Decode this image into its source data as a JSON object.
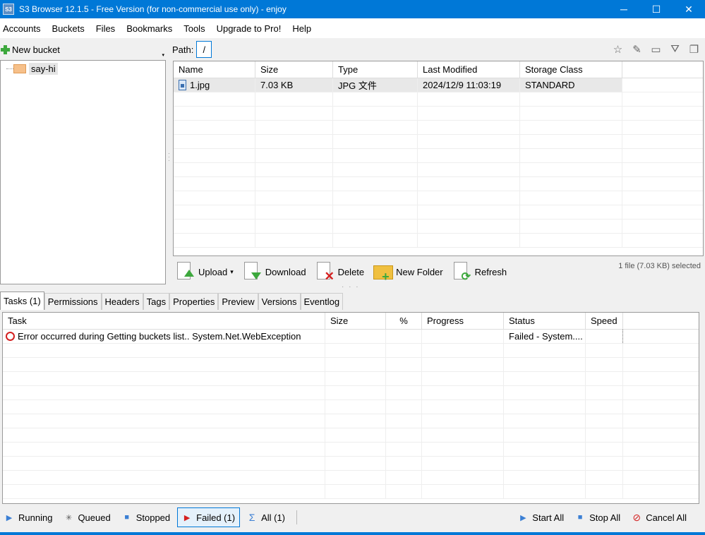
{
  "window": {
    "icon_text": "S3",
    "title": "S3 Browser 12.1.5 - Free Version (for non-commercial use only) - enjoy",
    "minimize": "─",
    "maximize": "☐",
    "close": "✕"
  },
  "menu": [
    "Accounts",
    "Buckets",
    "Files",
    "Bookmarks",
    "Tools",
    "Upgrade to Pro!",
    "Help"
  ],
  "left": {
    "new_bucket_label": "New bucket",
    "dropdown_glyph": "▾",
    "buckets": [
      "say-hi"
    ]
  },
  "path": {
    "label": "Path:",
    "value": "/"
  },
  "right_icons": {
    "star": "☆",
    "edit": "✎",
    "window": "▭",
    "filter": "⛛",
    "copy": "❐"
  },
  "files": {
    "columns": [
      "Name",
      "Size",
      "Type",
      "Last Modified",
      "Storage Class"
    ],
    "rows": [
      {
        "name": "1.jpg",
        "size": "7.03 KB",
        "type": "JPG 文件",
        "modified": "2024/12/9 11:03:19",
        "storage": "STANDARD"
      }
    ]
  },
  "actions": {
    "upload": "Upload",
    "upload_dropdown": "▾",
    "download": "Download",
    "delete": "Delete",
    "new_folder": "New Folder",
    "refresh": "Refresh",
    "selection_status": "1 file (7.03 KB) selected",
    "refresh_glyph": "⟳",
    "delete_glyph": "✕",
    "new_folder_glyph": "+"
  },
  "tabs": [
    "Tasks (1)",
    "Permissions",
    "Headers",
    "Tags",
    "Properties",
    "Preview",
    "Versions",
    "Eventlog"
  ],
  "tasks": {
    "columns": [
      "Task",
      "Size",
      "%",
      "Progress",
      "Status",
      "Speed"
    ],
    "rows": [
      {
        "task": "Error occurred during Getting buckets list.. System.Net.WebException",
        "size": "",
        "percent": "",
        "progress": "",
        "status": "Failed - System....",
        "speed": ""
      }
    ]
  },
  "bottom": {
    "running": "Running",
    "queued": "Queued",
    "stopped": "Stopped",
    "failed": "Failed (1)",
    "all": "All (1)",
    "start_all": "Start All",
    "stop_all": "Stop All",
    "cancel_all": "Cancel All",
    "glyphs": {
      "running": "▶",
      "queued": "✳",
      "stopped": "■",
      "failed": "▶",
      "all": "Σ",
      "start_all": "▶",
      "stop_all": "■",
      "cancel_all": "⊘"
    }
  }
}
